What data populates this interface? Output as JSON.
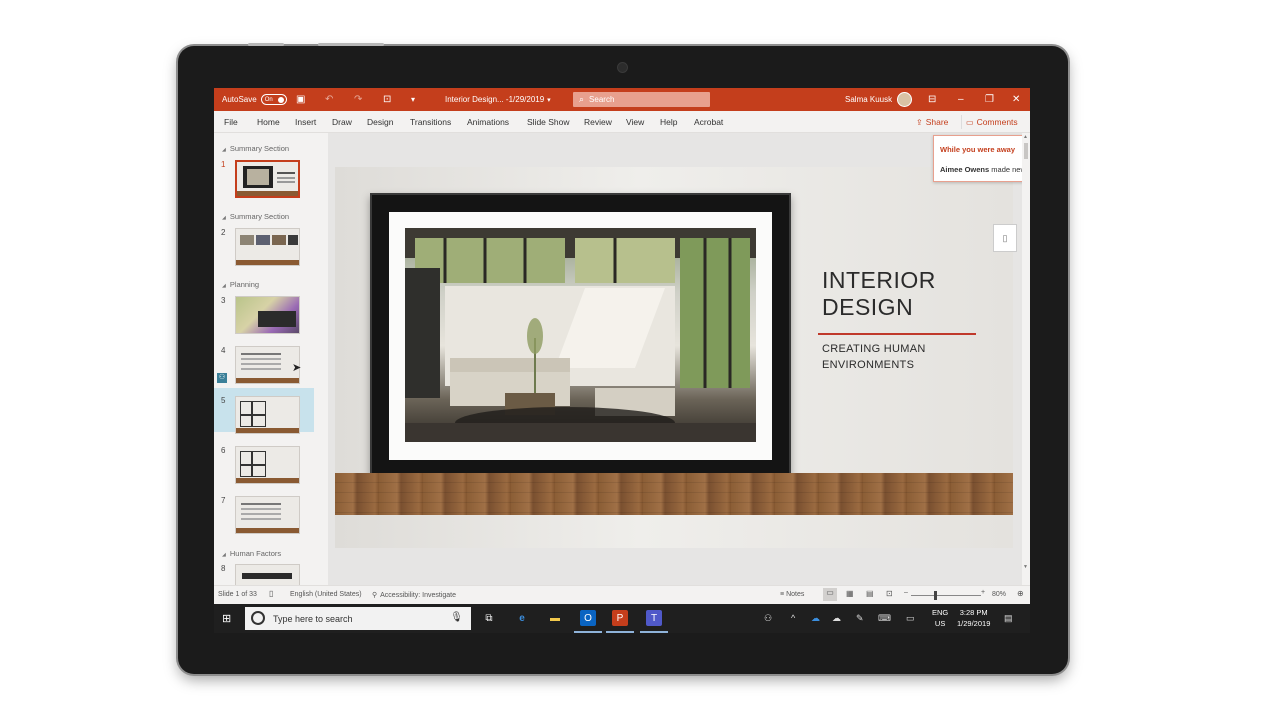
{
  "titlebar": {
    "autosave_label": "AutoSave",
    "autosave_state": "On",
    "doc_title": "Interior Design... -1/29/2019",
    "search_placeholder": "Search",
    "user_name": "Salma Kuusk"
  },
  "ribbon": {
    "tabs": [
      "File",
      "Home",
      "Insert",
      "Draw",
      "Design",
      "Transitions",
      "Animations",
      "Slide Show",
      "Review",
      "View",
      "Help",
      "Acrobat"
    ],
    "share_label": "Share",
    "comments_label": "Comments"
  },
  "thumbnails": {
    "sections": [
      "Summary Section",
      "Summary Section",
      "Planning",
      "Human Factors"
    ],
    "numbers": [
      "1",
      "2",
      "3",
      "4",
      "5",
      "6",
      "7",
      "8"
    ]
  },
  "slide": {
    "title": "INTERIOR\nDESIGN",
    "subtitle": "CREATING HUMAN\nENVIRONMENTS"
  },
  "notification": {
    "heading": "While you were away",
    "author": "Aimee Owens",
    "message": "made new changes."
  },
  "statusbar": {
    "slide_count": "Slide 1 of 33",
    "language": "English (United States)",
    "accessibility": "Accessibility: Investigate",
    "notes": "Notes",
    "zoom": "80%",
    "zoom_level": 0.8
  },
  "taskbar": {
    "search_placeholder": "Type here to search",
    "lang_top": "ENG",
    "lang_bottom": "US",
    "time": "3:28 PM",
    "date": "1/29/2019"
  },
  "colors": {
    "accent": "#c43e1c",
    "title_rule": "#c0392b",
    "taskbar": "#1f1f1f"
  }
}
